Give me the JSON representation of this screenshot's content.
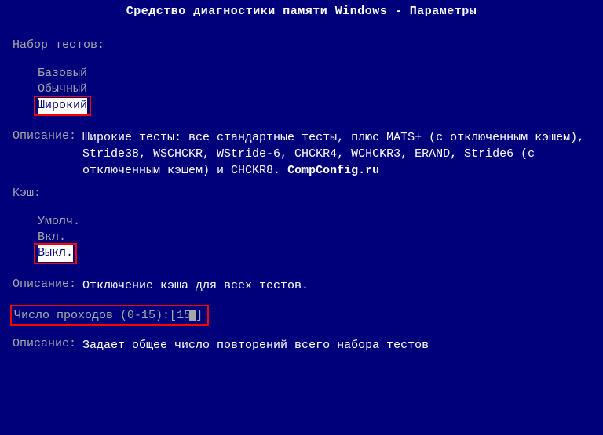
{
  "title": "Средство диагностики памяти Windows - Параметры",
  "test_set": {
    "label": "Набор тестов:",
    "options": [
      "Базовый",
      "Обычный",
      "Широкий"
    ],
    "selected_index": 2,
    "description_label": "Описание:",
    "description": "Широкие тесты: все стандартные тесты, плюс MATS+ (с отключенным кэшем), Stride38, WSCHCKR, WStride-6, CHCKR4, WCHCKR3, ERAND, Stride6 (с отключенным кэшем) и CHCKR8.",
    "site": "CompConfig.ru"
  },
  "cache": {
    "label": "Кэш:",
    "options": [
      "Умолч.",
      "Вкл.",
      "Выкл."
    ],
    "selected_index": 2,
    "description_label": "Описание:",
    "description": "Отключение кэша для всех тестов."
  },
  "passes": {
    "label": "Число проходов (0-15): ",
    "bracket_open": "[ ",
    "value": "15",
    "bracket_close": "]",
    "description_label": "Описание:",
    "description": "Задает общее число повторений всего набора тестов"
  }
}
